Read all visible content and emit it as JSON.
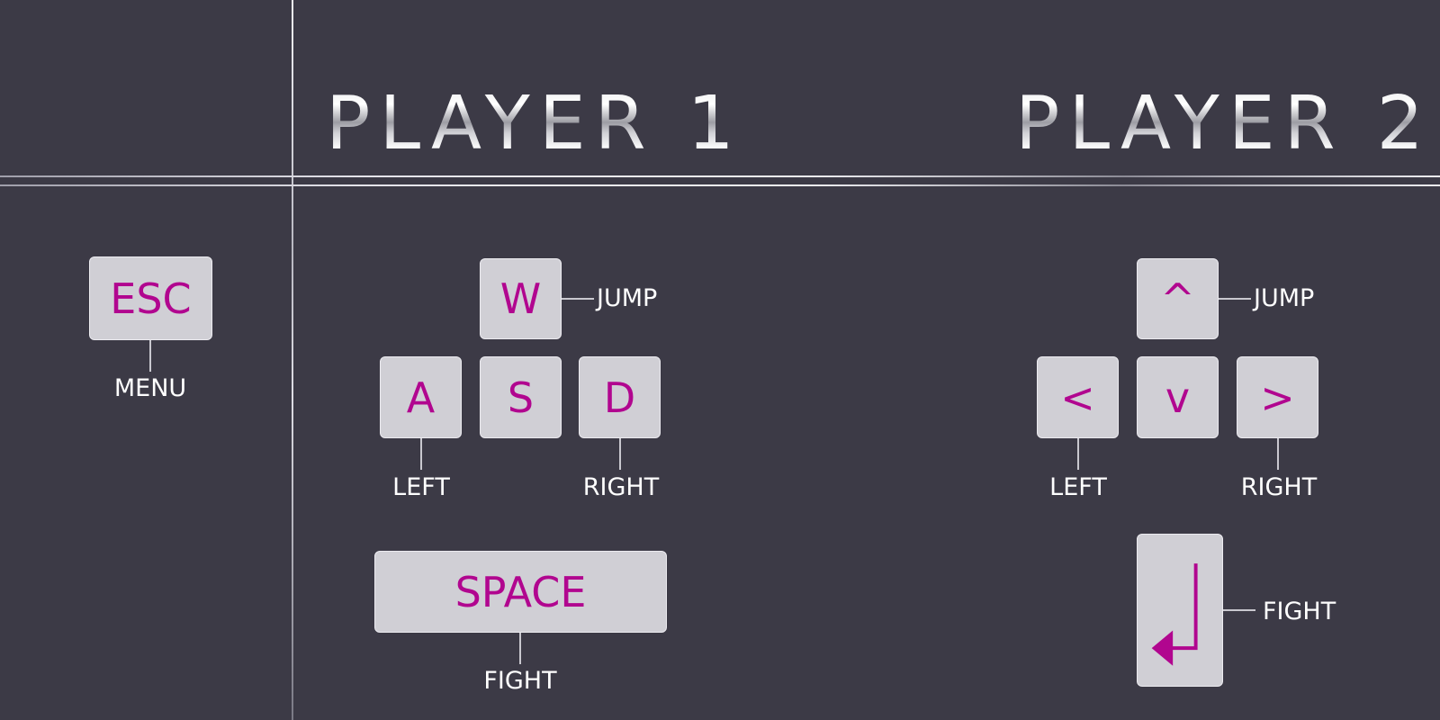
{
  "player1": {
    "title": "PLAYER 1",
    "keys": {
      "up": "W",
      "left": "A",
      "down": "S",
      "right": "D",
      "fight": "SPACE"
    },
    "actions": {
      "jump": "JUMP",
      "left": "LEFT",
      "right": "RIGHT",
      "fight": "FIGHT"
    }
  },
  "player2": {
    "title": "PLAYER 2",
    "keys": {
      "up": "^",
      "left": "<",
      "down": "v",
      "right": ">",
      "fight_icon": "enter-arrow-icon"
    },
    "actions": {
      "jump": "JUMP",
      "left": "LEFT",
      "right": "RIGHT",
      "fight": "FIGHT"
    }
  },
  "menu": {
    "key": "ESC",
    "action": "MENU"
  },
  "colors": {
    "background": "#3c3a46",
    "key_face": "#d0cfd5",
    "key_text": "#b1068f",
    "label": "#ffffff"
  }
}
